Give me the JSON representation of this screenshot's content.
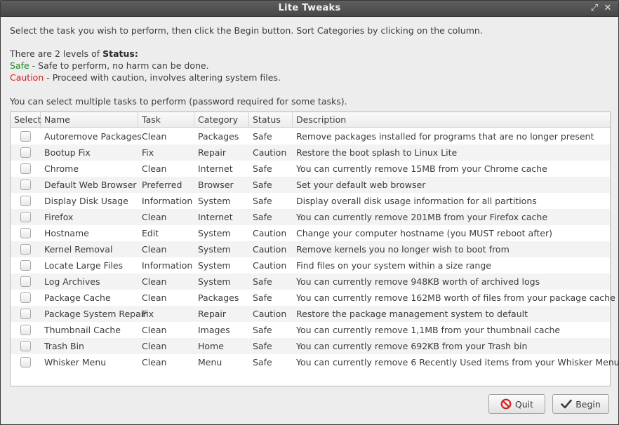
{
  "window": {
    "title": "Lite Tweaks"
  },
  "intro": {
    "line1": "Select the task you wish to perform, then click the Begin button. Sort Categories by clicking on the column.",
    "levels_prefix": "There are 2 levels of ",
    "levels_bold": "Status:",
    "safe_word": "Safe",
    "safe_desc": " - Safe to perform, no harm can be done.",
    "caution_word": "Caution",
    "caution_desc": " - Proceed with caution, involves altering system files.",
    "multi": "You can select multiple tasks to perform (password required for some tasks)."
  },
  "table": {
    "columns": [
      "Select",
      "Name",
      "Task",
      "Category",
      "Status",
      "Description"
    ],
    "rows": [
      {
        "name": "Autoremove Packages",
        "task": "Clean",
        "category": "Packages",
        "status": "Safe",
        "description": "Remove packages installed for programs that are no longer present"
      },
      {
        "name": "Bootup Fix",
        "task": "Fix",
        "category": "Repair",
        "status": "Caution",
        "description": "Restore the boot splash to Linux Lite"
      },
      {
        "name": "Chrome",
        "task": "Clean",
        "category": "Internet",
        "status": "Safe",
        "description": "You can currently remove 15MB from your Chrome cache"
      },
      {
        "name": "Default Web Browser",
        "task": "Preferred",
        "category": "Browser",
        "status": "Safe",
        "description": "Set your default web browser"
      },
      {
        "name": "Display Disk Usage",
        "task": "Information",
        "category": "System",
        "status": "Safe",
        "description": "Display overall disk usage information for all partitions"
      },
      {
        "name": "Firefox",
        "task": "Clean",
        "category": "Internet",
        "status": "Safe",
        "description": "You can currently remove 201MB from your Firefox cache"
      },
      {
        "name": "Hostname",
        "task": "Edit",
        "category": "System",
        "status": "Caution",
        "description": "Change your computer hostname (you MUST reboot after)"
      },
      {
        "name": "Kernel Removal",
        "task": "Clean",
        "category": "System",
        "status": "Caution",
        "description": "Remove kernels you no longer wish to boot from"
      },
      {
        "name": "Locate Large Files",
        "task": "Information",
        "category": "System",
        "status": "Caution",
        "description": "Find files on your system within a size range"
      },
      {
        "name": "Log Archives",
        "task": "Clean",
        "category": "System",
        "status": "Safe",
        "description": "You can currently remove 948KB worth of archived logs"
      },
      {
        "name": "Package Cache",
        "task": "Clean",
        "category": "Packages",
        "status": "Safe",
        "description": "You can currently remove 162MB worth of files from your package cache"
      },
      {
        "name": "Package System Repair",
        "task": "Fix",
        "category": "Repair",
        "status": "Caution",
        "description": "Restore the package management system to default"
      },
      {
        "name": "Thumbnail Cache",
        "task": "Clean",
        "category": "Images",
        "status": "Safe",
        "description": "You can currently remove 1,1MB from your thumbnail cache"
      },
      {
        "name": "Trash Bin",
        "task": "Clean",
        "category": "Home",
        "status": "Safe",
        "description": "You can currently remove 692KB from your Trash bin"
      },
      {
        "name": "Whisker Menu",
        "task": "Clean",
        "category": "Menu",
        "status": "Safe",
        "description": "You can currently remove 6 Recently Used items from your Whisker Menu"
      }
    ]
  },
  "buttons": {
    "quit": "Quit",
    "begin": "Begin"
  },
  "icons": {
    "maximize": "maximize-icon",
    "close": "close-icon",
    "quit": "no-entry-icon",
    "begin": "checkmark-icon"
  },
  "colors": {
    "safe": "#1f8a1f",
    "caution": "#d11a1a",
    "quit_icon": "#d42020"
  }
}
